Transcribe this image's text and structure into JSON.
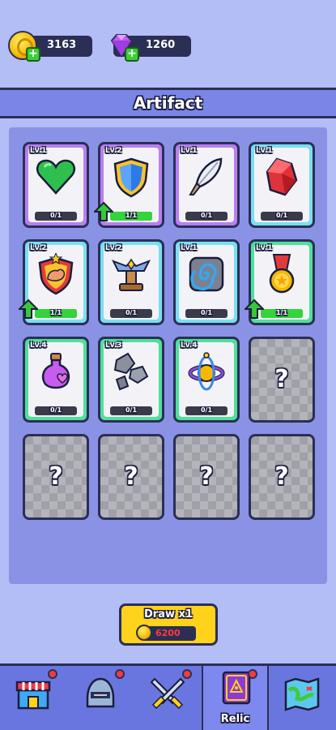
{
  "currency": {
    "gold": "3163",
    "gems": "1260"
  },
  "header": {
    "title": "Artifact"
  },
  "artifacts": [
    {
      "level": "Lv.1",
      "progress": "0/1",
      "progress_fraction": 0,
      "icon": "green-heart-icon",
      "upgrade": false,
      "rarity": "purple"
    },
    {
      "level": "Lv.2",
      "progress": "1/1",
      "progress_fraction": 1,
      "icon": "blue-shield-icon",
      "upgrade": true,
      "rarity": "purple"
    },
    {
      "level": "Lv.1",
      "progress": "0/1",
      "progress_fraction": 0,
      "icon": "feather-quill-icon",
      "upgrade": false,
      "rarity": "purple"
    },
    {
      "level": "Lv.1",
      "progress": "0/1",
      "progress_fraction": 0,
      "icon": "red-gem-icon",
      "upgrade": false,
      "rarity": "blue"
    },
    {
      "level": "Lv.2",
      "progress": "1/1",
      "progress_fraction": 1,
      "icon": "strength-shield-icon",
      "upgrade": true,
      "rarity": "blue"
    },
    {
      "level": "Lv.2",
      "progress": "0/1",
      "progress_fraction": 0,
      "icon": "winged-pedestal-icon",
      "upgrade": false,
      "rarity": "blue"
    },
    {
      "level": "Lv.1",
      "progress": "0/1",
      "progress_fraction": 0,
      "icon": "spiral-stone-icon",
      "upgrade": false,
      "rarity": "blue"
    },
    {
      "level": "Lv.1",
      "progress": "1/1",
      "progress_fraction": 1,
      "icon": "medal-icon",
      "upgrade": true,
      "rarity": "green"
    },
    {
      "level": "Lv.4",
      "progress": "0/1",
      "progress_fraction": 0,
      "icon": "potion-icon",
      "upgrade": false,
      "rarity": "green"
    },
    {
      "level": "Lv.3",
      "progress": "0/1",
      "progress_fraction": 0,
      "icon": "rocks-icon",
      "upgrade": false,
      "rarity": "green"
    },
    {
      "level": "Lv.4",
      "progress": "0/1",
      "progress_fraction": 0,
      "icon": "gyroscope-orb-icon",
      "upgrade": false,
      "rarity": "green"
    }
  ],
  "empty_slot_label": "?",
  "draw": {
    "label": "Draw x1",
    "cost": "6200"
  },
  "nav": [
    {
      "name": "shop",
      "icon": "shop-icon",
      "label": "",
      "active": false,
      "badge": true
    },
    {
      "name": "hero",
      "icon": "helmet-icon",
      "label": "",
      "active": false,
      "badge": true
    },
    {
      "name": "battle",
      "icon": "crossed-swords-icon",
      "label": "",
      "active": false,
      "badge": true
    },
    {
      "name": "relic",
      "icon": "spellbook-icon",
      "label": "Relic",
      "active": true,
      "badge": true
    },
    {
      "name": "map",
      "icon": "map-icon",
      "label": "",
      "active": false,
      "badge": false
    }
  ],
  "colors": {
    "background": "#b3bdf6",
    "panel": "#8a92e6",
    "banner": "#7a85e8",
    "rarity_purple": "#b77ff0",
    "rarity_blue": "#79dff2",
    "rarity_green": "#4fe09a",
    "progress_fill": "#34d43a",
    "draw_button": "#ffd21c",
    "cost_text": "#ff3b3b"
  }
}
